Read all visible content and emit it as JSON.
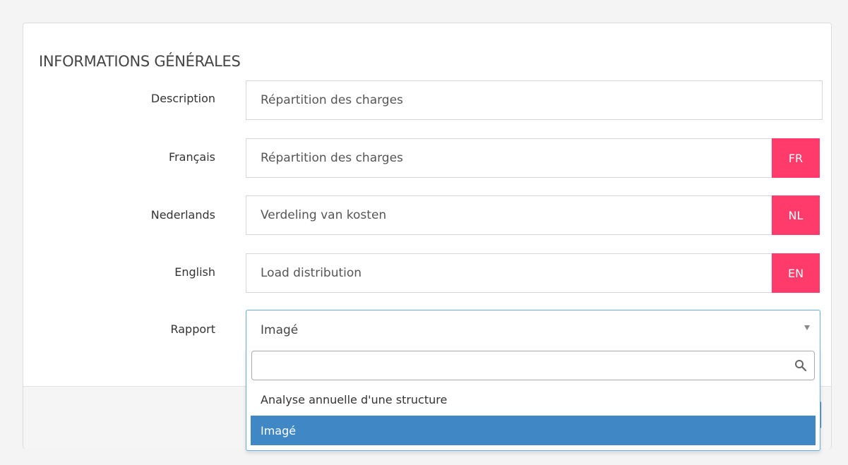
{
  "section": {
    "title": "INFORMATIONS GÉNÉRALES"
  },
  "fields": {
    "description": {
      "label": "Description",
      "value": "Répartition des charges"
    },
    "french": {
      "label": "Français",
      "value": "Répartition des charges",
      "addon": "FR"
    },
    "dutch": {
      "label": "Nederlands",
      "value": "Verdeling van kosten",
      "addon": "NL"
    },
    "english": {
      "label": "English",
      "value": "Load distribution",
      "addon": "EN"
    },
    "rapport": {
      "label": "Rapport",
      "selected": "Imagé",
      "search_value": "",
      "options": [
        "Analyse annuelle d'une structure",
        "Imagé"
      ]
    }
  },
  "colors": {
    "addon_background": "#ff3b6b",
    "selected_option": "#3f87c5",
    "focus_border": "#66aee6"
  }
}
